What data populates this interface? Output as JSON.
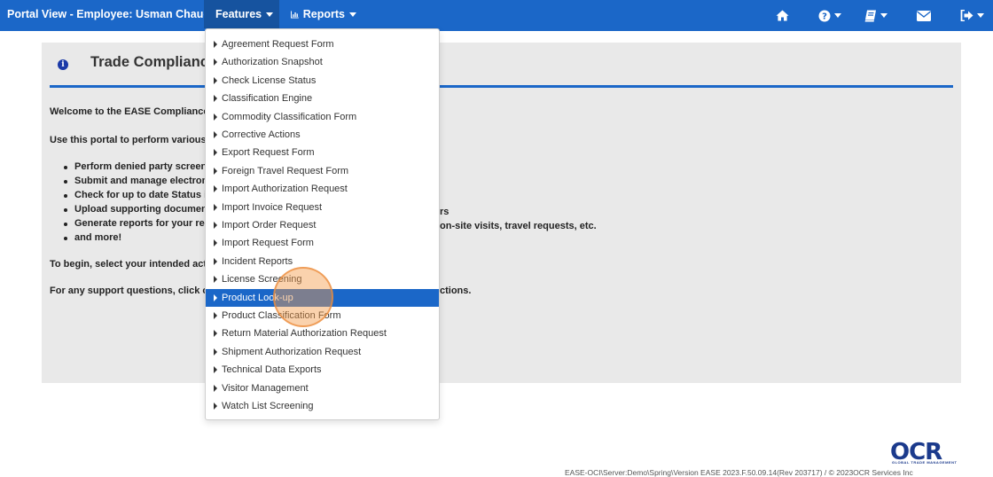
{
  "navbar": {
    "brand": "Portal View - Employee: Usman Chaudhry",
    "features_label": "Features",
    "reports_label": "Reports",
    "icons": [
      "home-icon",
      "question-circle-icon",
      "book-icon",
      "envelope-icon",
      "sign-out-icon"
    ]
  },
  "panel": {
    "title": "Trade Compliance",
    "welcome": "Welcome to the EASE Compliance",
    "intro": "Use this portal to perform various a",
    "bullets": [
      "Perform denied party screeni",
      "Submit and manage electroni",
      "Check for up to date Status i",
      "Upload supporting document",
      "Generate reports for your rec",
      "and more!"
    ],
    "bullet_tail_1": "rs",
    "bullet_tail_2": "on-site visits, travel requests, etc.",
    "begin": "To begin, select your intended activ",
    "support": "For any support questions, click or",
    "support_tail": "ctions."
  },
  "features_menu": {
    "items": [
      "Agreement Request Form",
      "Authorization Snapshot",
      "Check License Status",
      "Classification Engine",
      "Commodity Classification Form",
      "Corrective Actions",
      "Export Request Form",
      "Foreign Travel Request Form",
      "Import Authorization Request",
      "Import Invoice Request",
      "Import Order Request",
      "Import Request Form",
      "Incident Reports",
      "License Screening",
      "Product Look-up",
      "Product Classification Form",
      "Return Material Authorization Request",
      "Shipment Authorization Request",
      "Technical Data Exports",
      "Visitor Management",
      "Watch List Screening"
    ],
    "active_item": "Product Look-up"
  },
  "footer": {
    "logo_text": "OCR",
    "logo_tagline": "GLOBAL TRADE MANAGEMENT",
    "version_text": "EASE-OCI\\Server:Demo\\Spring\\Version EASE 2023.F.50.09.14(Rev 203717)  /  © 2023OCR Services Inc"
  },
  "colors": {
    "navbar": "#1b67c8",
    "navbar_active": "#16539f",
    "panel_bg": "#e9e9e9",
    "menu_active": "#1b67c8",
    "click_marker": "#f39c49"
  }
}
